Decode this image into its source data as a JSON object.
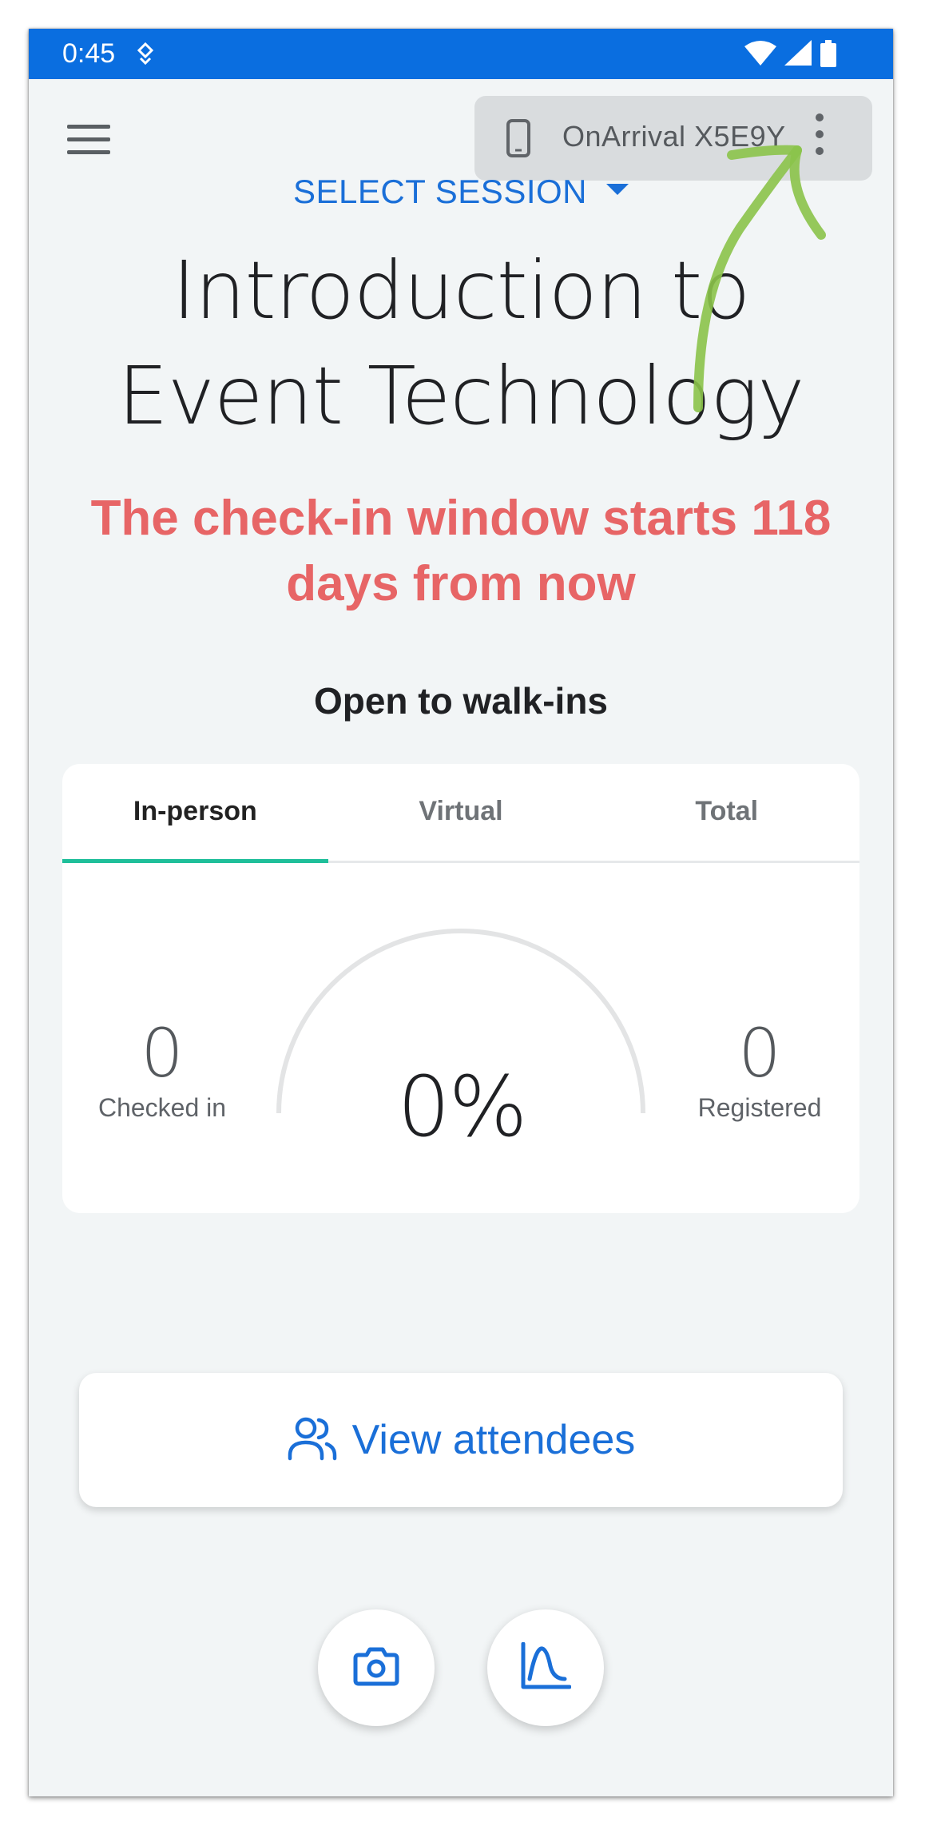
{
  "status_bar": {
    "time": "0:45",
    "color": "#0a6ee0",
    "icons": [
      "notification-icon",
      "wifi-icon",
      "signal-icon",
      "battery-icon"
    ]
  },
  "header": {
    "menu_icon": "hamburger-menu-icon",
    "device": {
      "icon": "phone-icon",
      "name": "OnArrival X5E9Y",
      "more_icon": "more-vertical-icon"
    }
  },
  "session": {
    "select_label": "SELECT SESSION",
    "title_line1": "Introduction to",
    "title_line2": "Event Technology"
  },
  "checkin": {
    "message": "The check-in window starts 118 days from now",
    "color": "#e76566"
  },
  "walkins": {
    "heading": "Open to walk-ins"
  },
  "stats": {
    "tabs": [
      {
        "label": "In-person",
        "active": true
      },
      {
        "label": "Virtual",
        "active": false
      },
      {
        "label": "Total",
        "active": false
      }
    ],
    "checked_in": {
      "value": "0",
      "label": "Checked in"
    },
    "registered": {
      "value": "0",
      "label": "Registered"
    },
    "percent": "0%",
    "progress_fraction": 0,
    "accent": "#1fbf9a"
  },
  "actions": {
    "view_attendees": "View attendees",
    "view_attendees_icon": "users-icon",
    "fab_camera_icon": "camera-icon",
    "fab_chart_icon": "chart-icon",
    "accent": "#1a6fd8"
  }
}
